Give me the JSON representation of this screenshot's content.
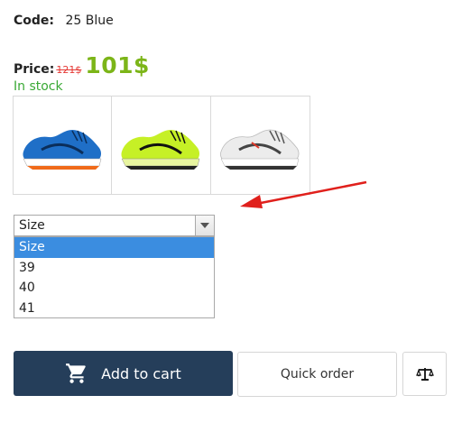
{
  "product": {
    "code_label": "Code:",
    "code_value": "25 Blue",
    "price_label": "Price:",
    "price_old": "121$",
    "price_new": "101$",
    "stock": "In stock"
  },
  "thumbnails": [
    {
      "icon": "blue-sneaker",
      "color": "#1f6fc7"
    },
    {
      "icon": "lime-sneaker",
      "color": "#c6f026"
    },
    {
      "icon": "white-sneaker",
      "color": "#ececec"
    }
  ],
  "size_select": {
    "selected": "Size",
    "options": [
      "Size",
      "39",
      "40",
      "41"
    ]
  },
  "actions": {
    "add_to_cart": "Add to cart",
    "quick_order": "Quick order",
    "compare_icon": "scales-icon"
  },
  "colors": {
    "price_new": "#7cb518",
    "price_old": "#e53935",
    "stock": "#3aa935",
    "cart_bg": "#253e5a",
    "option_highlight": "#3b8de0",
    "annotation_arrow": "#e0201c"
  }
}
